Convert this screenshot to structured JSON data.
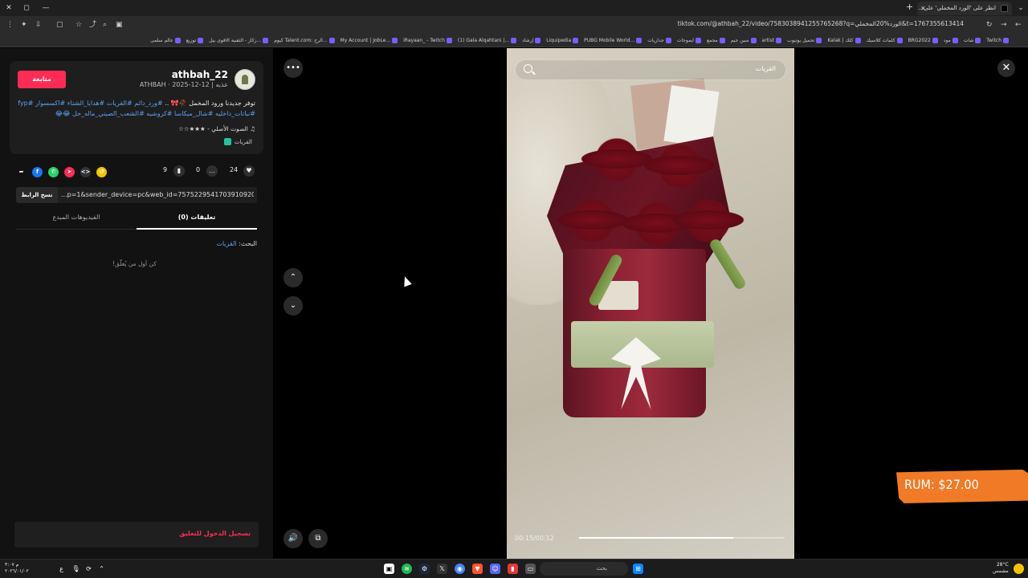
{
  "browser": {
    "tab_title": "انظر على 'الورد المخملي' على...",
    "url": "tiktok.com/@athbah_22/video/7583038941255765268?q=الورد%20المخملي&t=1767355613414",
    "bookmarks": [
      "Twitch",
      "شات",
      "مود",
      "BRG2022",
      "كلمات كلاسيك",
      "Kalak | كلك",
      "تحميل يوتيوب",
      "artist",
      "سين جيم",
      "مجمع",
      "ايموجات",
      "جداريات",
      "PUBG Mobile World...",
      "Liquipedia",
      "إرشاد",
      "(1) Gala Alqahtani |...",
      "iRayaan_ - Twitch",
      "My Account | JobLe...",
      "كيوم Talent.com: الرح...",
      "زكاز - الثقنية الاقوى بيل...",
      "توزيع",
      "عالم سلمى"
    ]
  },
  "post": {
    "follow_label": "متابعة",
    "username": "athbah_22",
    "subline": "عذبه | ATHBAH · 2025-12-12",
    "caption_text": "توفر جديدنا ورود المخمل 🥀🎀 .. ",
    "caption_tags": "#ورد_دائم #القريات #هدايا_الشتاء #اكسسوار #fyp #نباتات_داخليه #شال_ميكاسا #كروشيه #الشعب_الصيني_ماله_حل 😂😂",
    "music": "♫ الصوت الأصلي - ★★★☆☆",
    "place": "القريات"
  },
  "stats": {
    "likes": "24",
    "comments": "0",
    "saves": "9"
  },
  "share_link": {
    "text": "...p=1&sender_device=pc&web_id=7575229541703910920",
    "copy_label": "نسخ الرابط"
  },
  "tabs": {
    "comments": "تعليقات (0)",
    "creator_videos": "الفيديوهات المبدع"
  },
  "comments": {
    "search_prefix": "البحث:",
    "search_keyword": "القريات",
    "empty": "كن أول من يُعلّق!"
  },
  "login_prompt": "تسجيل الدخول للتعليق",
  "video": {
    "search_query": "القريات",
    "timecode": "00:15/00:12",
    "progress_played": 0.75
  },
  "overlay": {
    "price": "RUM: $27.00"
  },
  "taskbar": {
    "search_label": "بحث",
    "time": "م ٣:٠٧",
    "date": "٢٠٢٦/٠١/٠٢",
    "temp": "28°C",
    "weather": "مشمس"
  },
  "colors": {
    "accent": "#fe2c55",
    "link": "#5aa0f0",
    "price_bg": "#f07a26"
  }
}
